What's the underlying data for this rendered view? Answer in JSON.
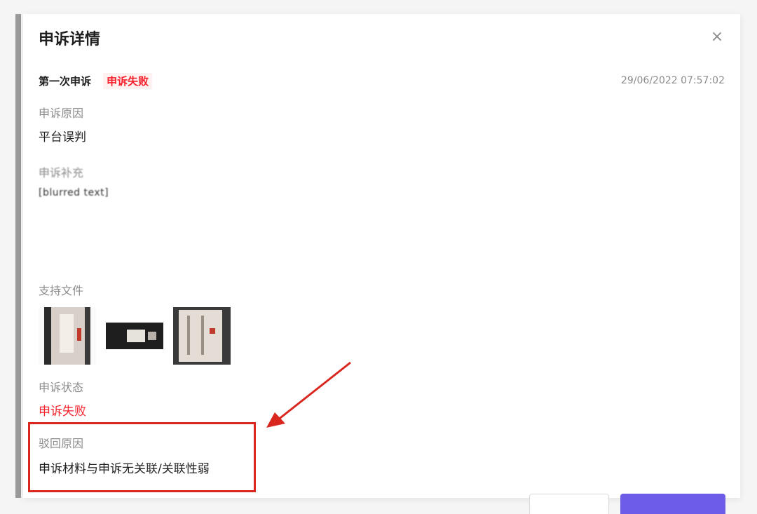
{
  "dialog": {
    "title": "申诉详情",
    "close_icon": "close-icon"
  },
  "appeal": {
    "number_label": "第一次申诉",
    "status_badge": "申诉失败",
    "timestamp": "29/06/2022 07:57:02"
  },
  "reason": {
    "label": "申诉原因",
    "value": "平台误判"
  },
  "description": {
    "label": "申诉补充",
    "text": "[blurred text]"
  },
  "files": {
    "label": "支持文件"
  },
  "status": {
    "label": "申诉状态",
    "value": "申诉失败"
  },
  "reject": {
    "label": "驳回原因",
    "value": "申诉材料与申诉无关联/关联性弱"
  },
  "colors": {
    "danger": "#f5222d",
    "primary": "#6c5ce7",
    "annotation": "#d9271f"
  }
}
